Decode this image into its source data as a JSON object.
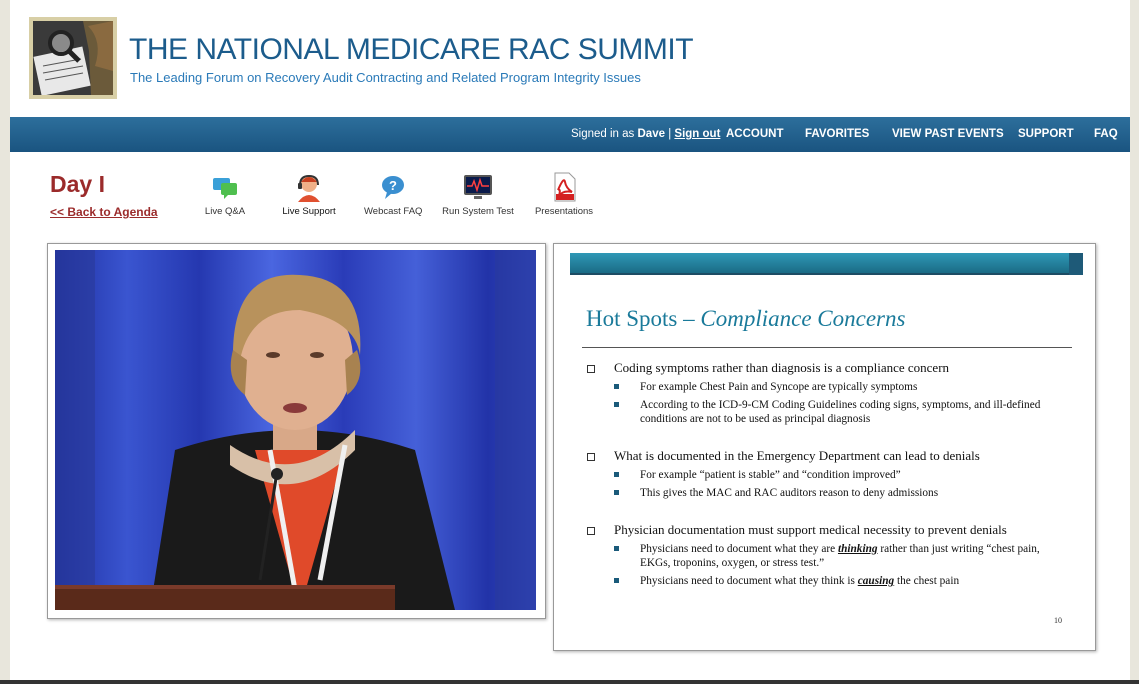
{
  "header": {
    "title": "THE NATIONAL MEDICARE RAC SUMMIT",
    "subtitle": "The Leading Forum on Recovery Audit Contracting and Related Program Integrity Issues"
  },
  "navbar": {
    "signed_in_prefix": "Signed in as",
    "user": "Dave",
    "separator": "|",
    "sign_out": "Sign out",
    "items": [
      "ACCOUNT",
      "FAVORITES",
      "VIEW PAST EVENTS",
      "SUPPORT",
      "FAQ"
    ]
  },
  "session": {
    "day": "Day I",
    "back_link": "<< Back to Agenda"
  },
  "tools": [
    {
      "label": "Live Q&A",
      "icon": "chat-bubbles-icon"
    },
    {
      "label": "Live Support",
      "icon": "support-agent-icon"
    },
    {
      "label": "Webcast FAQ",
      "icon": "help-bubble-icon"
    },
    {
      "label": "Run System Test",
      "icon": "monitor-test-icon"
    },
    {
      "label": "Presentations",
      "icon": "pdf-icon"
    }
  ],
  "slide": {
    "title_main": "Hot Spots – ",
    "title_italic": "Compliance Concerns",
    "number": "10",
    "bullets": [
      {
        "text": "Coding symptoms rather than diagnosis is a compliance concern",
        "sub": [
          "For example Chest Pain and Syncope are typically symptoms",
          "According to the ICD-9-CM Coding Guidelines coding signs, symptoms, and ill-defined conditions are not to be used as principal diagnosis"
        ]
      },
      {
        "text": "What is documented in the Emergency Department can lead to denials",
        "sub": [
          "For example “patient is stable” and “condition improved”",
          "This gives the MAC and RAC auditors reason to deny admissions"
        ]
      },
      {
        "text": "Physician documentation must support medical necessity to prevent denials",
        "sub_rich": [
          {
            "before": "Physicians need to document what they are ",
            "em": "thinking",
            "after": " rather than just writing “chest pain, EKGs, troponins, oxygen, or stress test.”"
          },
          {
            "before": "Physicians need to document what they think is ",
            "em": "causing",
            "after": " the chest pain"
          }
        ]
      }
    ]
  },
  "colors": {
    "brand_blue": "#1c5c8c",
    "nav_bar": "#1a5480",
    "day_red": "#9b2b2b",
    "slide_teal": "#1a7a9a"
  }
}
